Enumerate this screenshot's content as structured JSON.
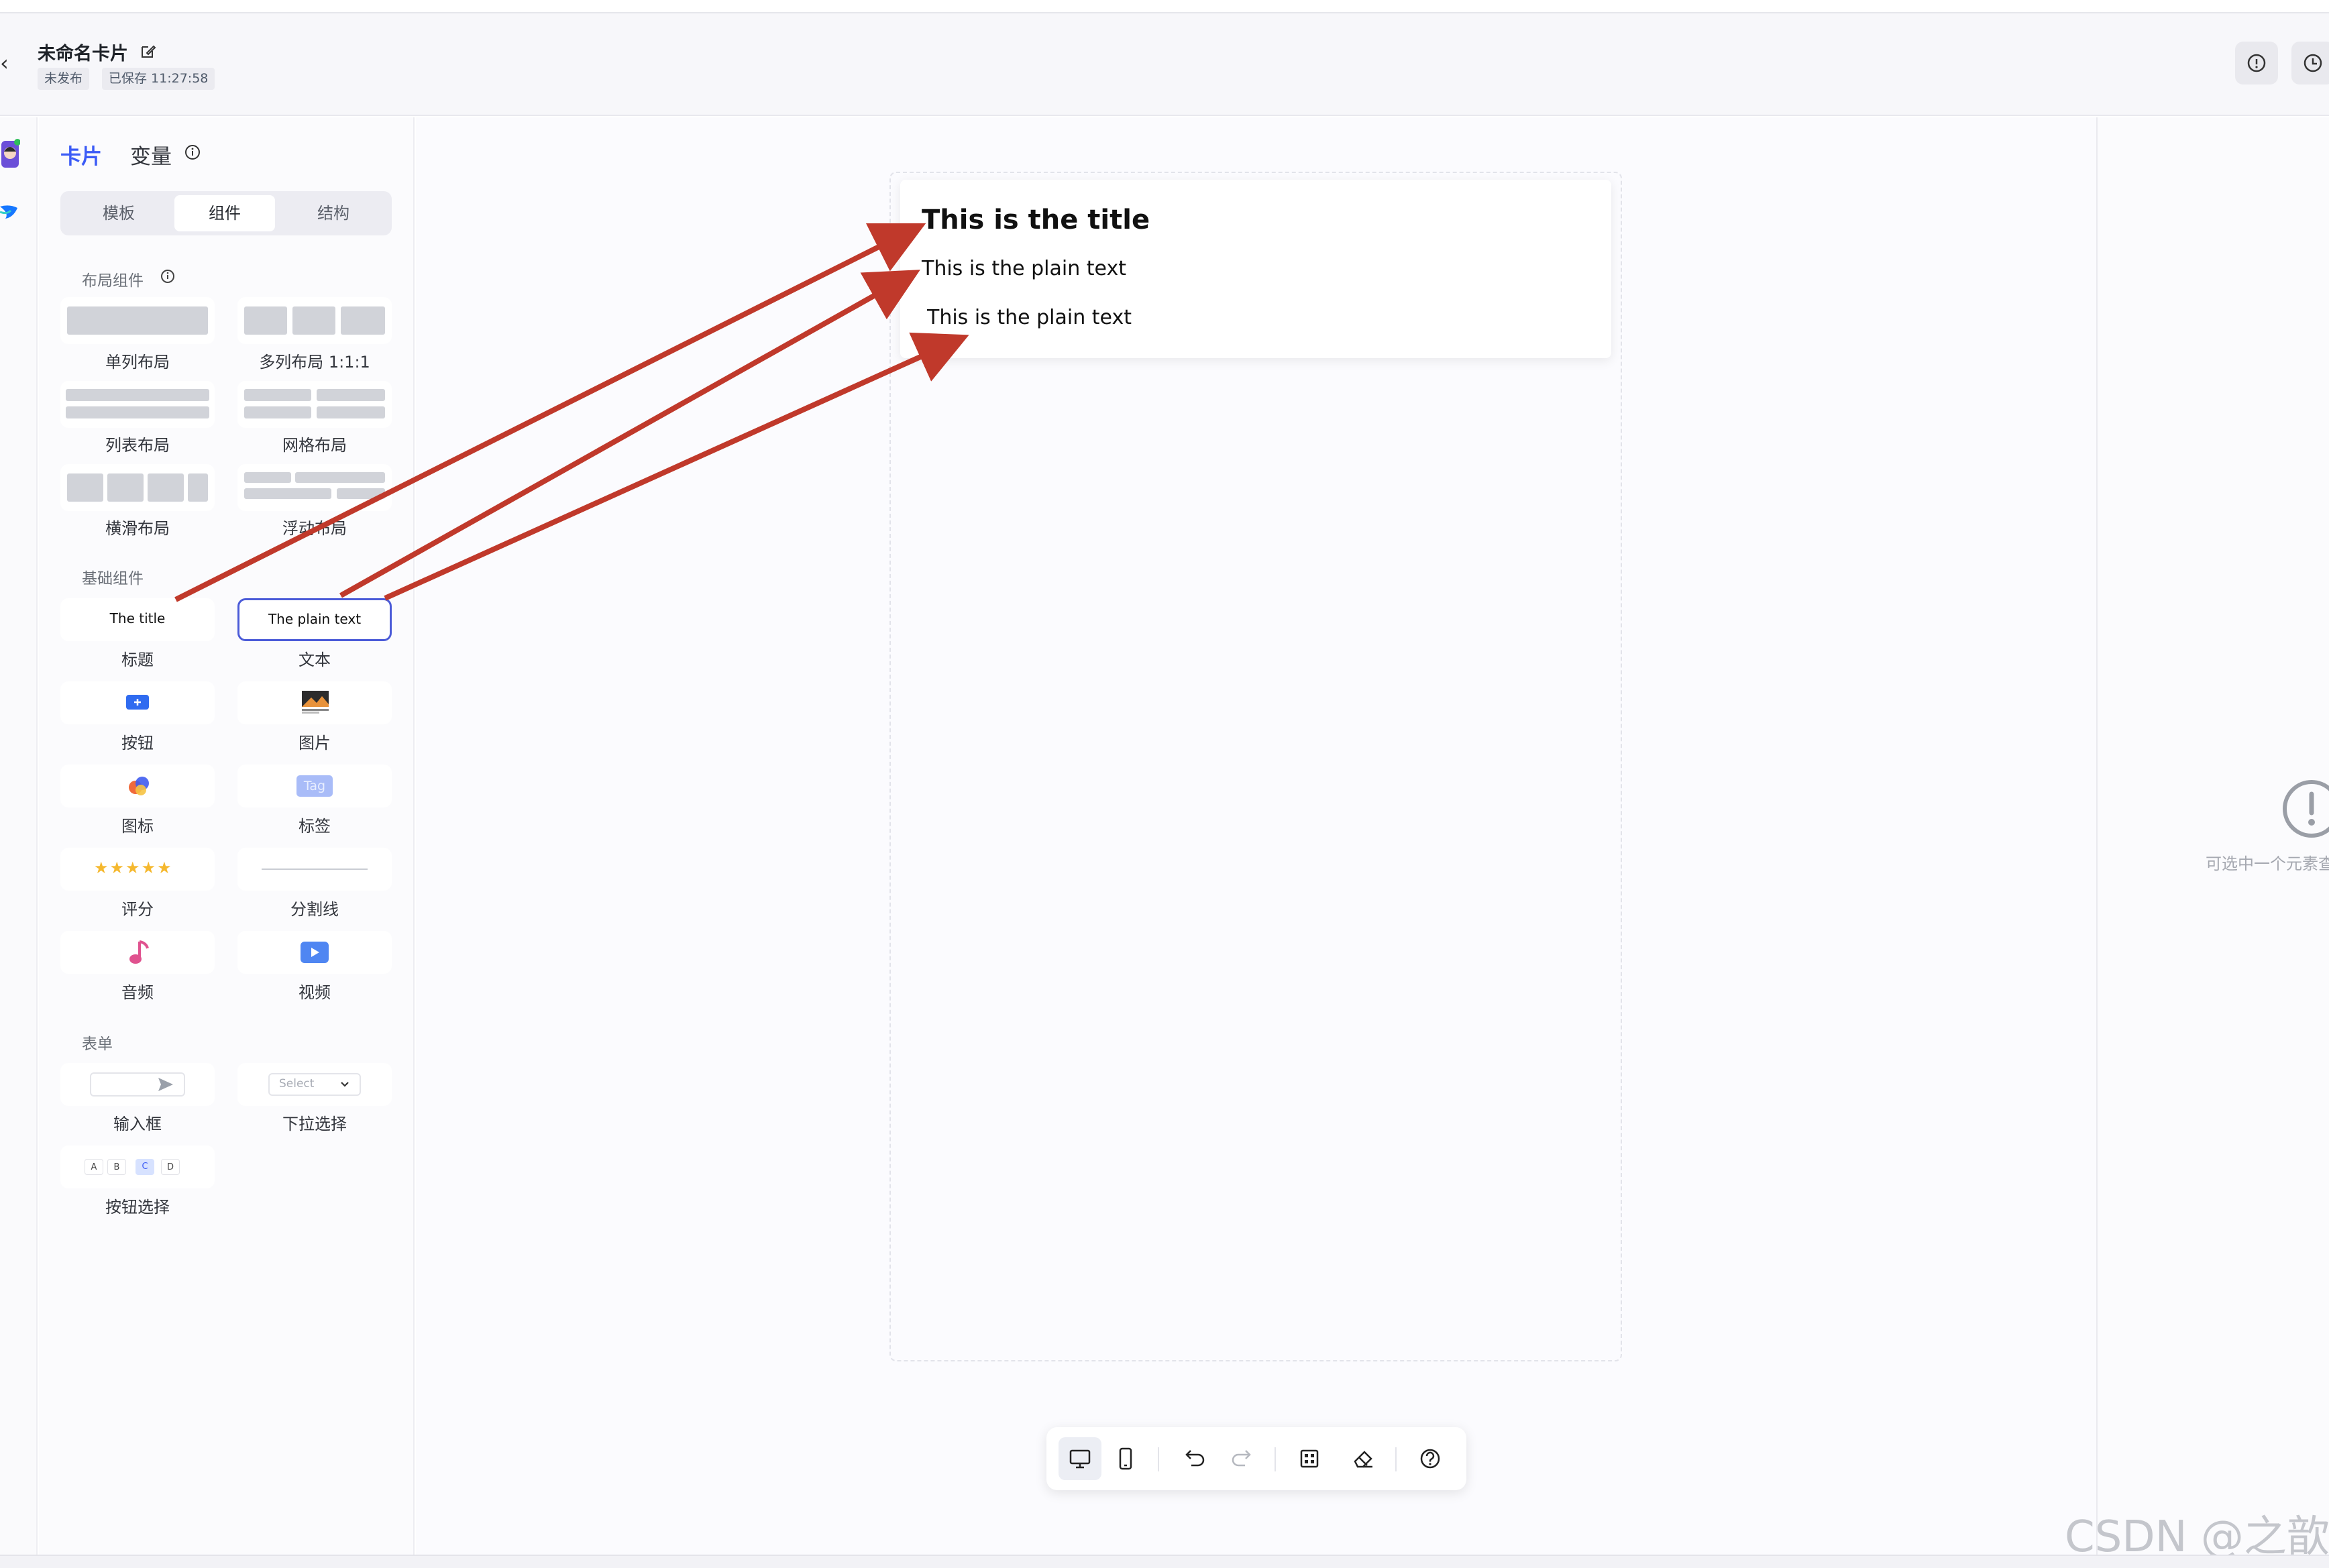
{
  "header": {
    "title": "未命名卡片",
    "status_unpublished": "未发布",
    "status_saved": "已保存 11:27:58"
  },
  "sidebar": {
    "tabs": [
      "卡片",
      "变量"
    ],
    "segments": [
      "模板",
      "组件",
      "结构"
    ],
    "active_segment": "组件",
    "sections": {
      "layout": {
        "title": "布局组件",
        "items": [
          "单列布局",
          "多列布局 1:1:1",
          "列表布局",
          "网格布局",
          "横滑布局",
          "浮动布局"
        ]
      },
      "basic": {
        "title": "基础组件",
        "items": [
          "标题",
          "文本",
          "按钮",
          "图片",
          "图标",
          "标签",
          "评分",
          "分割线",
          "音频",
          "视频"
        ],
        "title_preview": "The title",
        "text_preview": "The plain text",
        "tag_preview": "Tag"
      },
      "form": {
        "title": "表单",
        "items": [
          "输入框",
          "下拉选择",
          "按钮选择"
        ],
        "select_preview": "Select",
        "button_options": [
          "A",
          "B",
          "C",
          "D"
        ]
      }
    }
  },
  "canvas": {
    "card_title": "This is the title",
    "card_text_1": "This is the plain text",
    "card_text_2": "This is the plain text"
  },
  "right_panel": {
    "hint": "可选中一个元素查"
  },
  "watermark": "CSDN @之歆",
  "colors": {
    "accent": "#3b5bf6",
    "arrow": "#c0392b",
    "star": "#f5b82e"
  },
  "icons": [
    "back-icon",
    "edit-icon",
    "info-icon",
    "history-icon",
    "desktop-icon",
    "mobile-icon",
    "undo-icon",
    "redo-icon",
    "grid-icon",
    "eraser-icon",
    "help-icon",
    "alert-icon"
  ]
}
